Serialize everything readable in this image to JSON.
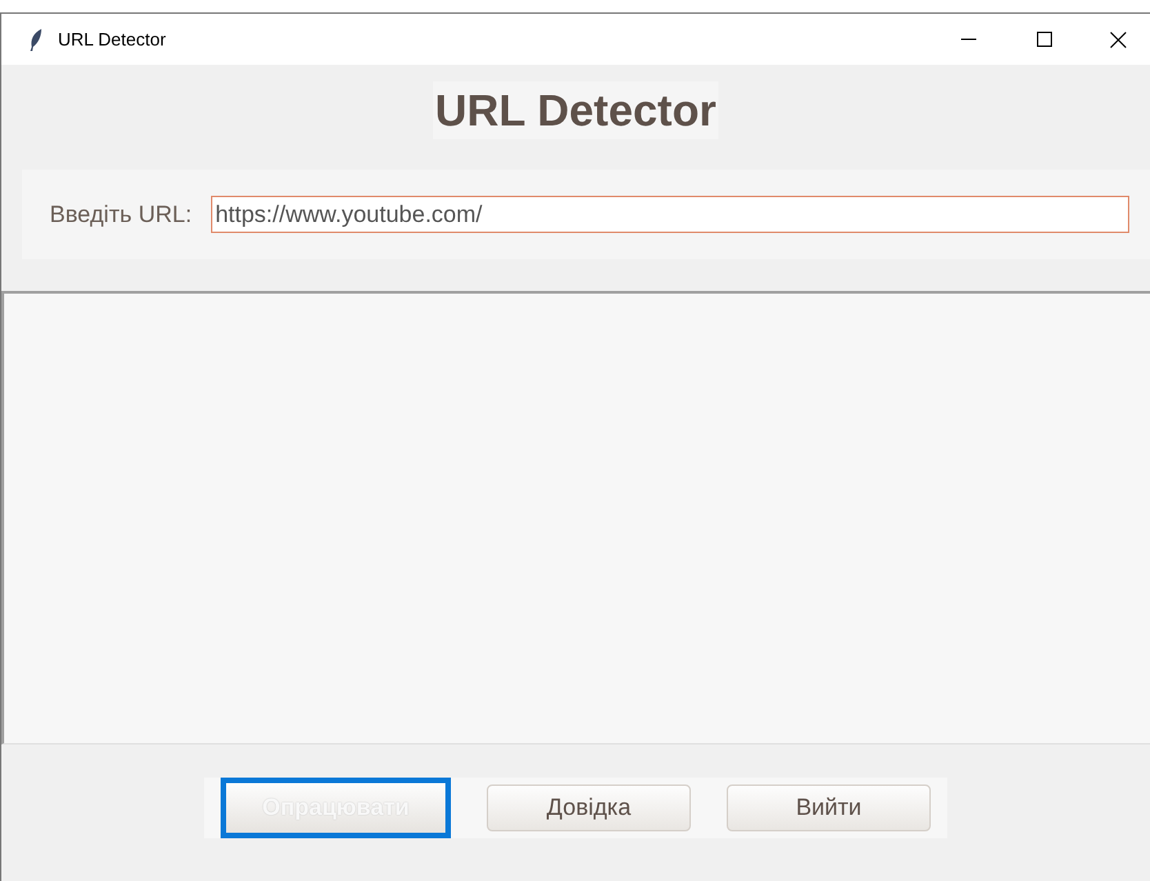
{
  "window": {
    "title": "URL Detector"
  },
  "heading": "URL Detector",
  "url": {
    "label": "Введіть URL:",
    "value": "https://www.youtube.com/"
  },
  "buttons": [
    {
      "label": "Опрацювати",
      "focused": true
    },
    {
      "label": "Довідка",
      "focused": false
    },
    {
      "label": "Вийти",
      "focused": false
    }
  ]
}
